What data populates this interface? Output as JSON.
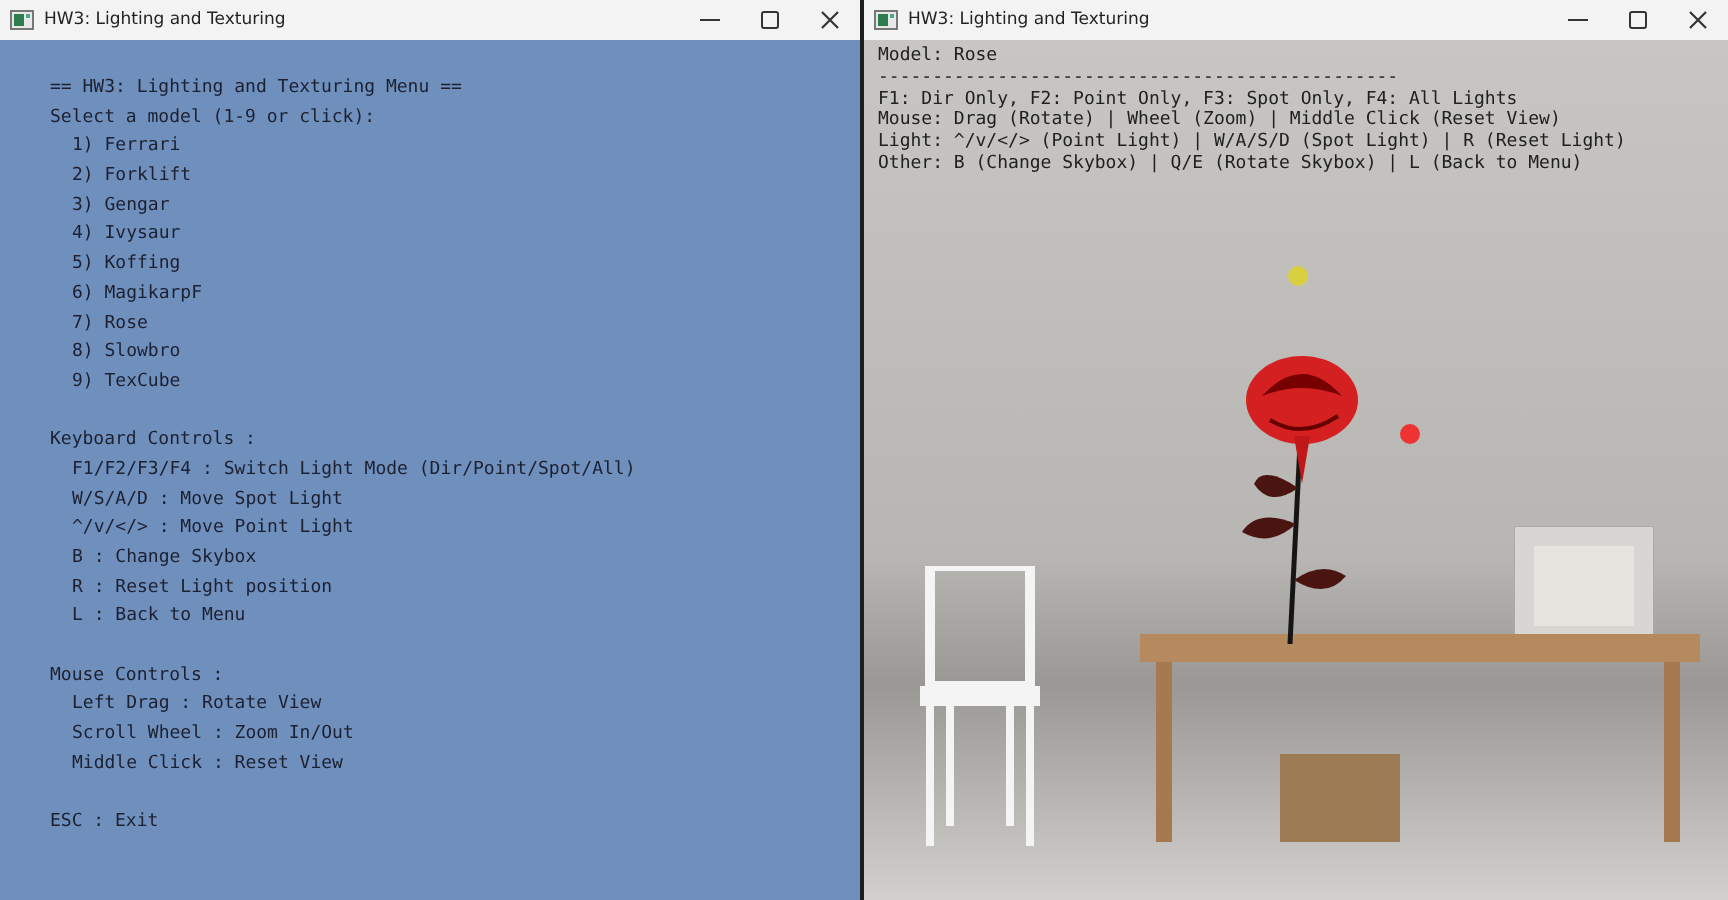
{
  "windows": [
    {
      "kind": "menu",
      "title": "HW3: Lighting and Texturing",
      "menu": {
        "heading": "== HW3: Lighting and Texturing Menu ==",
        "prompt": "Select a model (1-9 or click):",
        "models": [
          "1) Ferrari",
          "2) Forklift",
          "3) Gengar",
          "4) Ivysaur",
          "5) Koffing",
          "6) MagikarpF",
          "7) Rose",
          "8) Slowbro",
          "9) TexCube"
        ],
        "sections": [
          {
            "title": "Keyboard Controls :",
            "items": [
              "F1/F2/F3/F4 : Switch Light Mode (Dir/Point/Spot/All)",
              "W/S/A/D : Move Spot Light",
              "^/v/</> : Move Point Light",
              "B : Change Skybox",
              "R : Reset Light position",
              "L : Back to Menu"
            ]
          },
          {
            "title": "Mouse Controls :",
            "items": [
              "Left Drag : Rotate View",
              "Scroll Wheel : Zoom In/Out",
              "Middle Click : Reset View"
            ]
          }
        ],
        "exit": "ESC : Exit"
      }
    },
    {
      "kind": "viewer",
      "title": "HW3: Lighting and Texturing",
      "overlay": {
        "model": "Model: Rose",
        "separator": "------------------------------------------------",
        "lines": [
          "F1: Dir Only, F2: Point Only, F3: Spot Only, F4: All Lights",
          "Mouse: Drag (Rotate) | Wheel (Zoom) | Middle Click (Reset View)",
          "Light: ^/v/</> (Point Light) | W/A/S/D (Spot Light) | R (Reset Light)",
          "Other: B (Change Skybox) | Q/E (Rotate Skybox) | L (Back to Menu)"
        ]
      }
    }
  ]
}
